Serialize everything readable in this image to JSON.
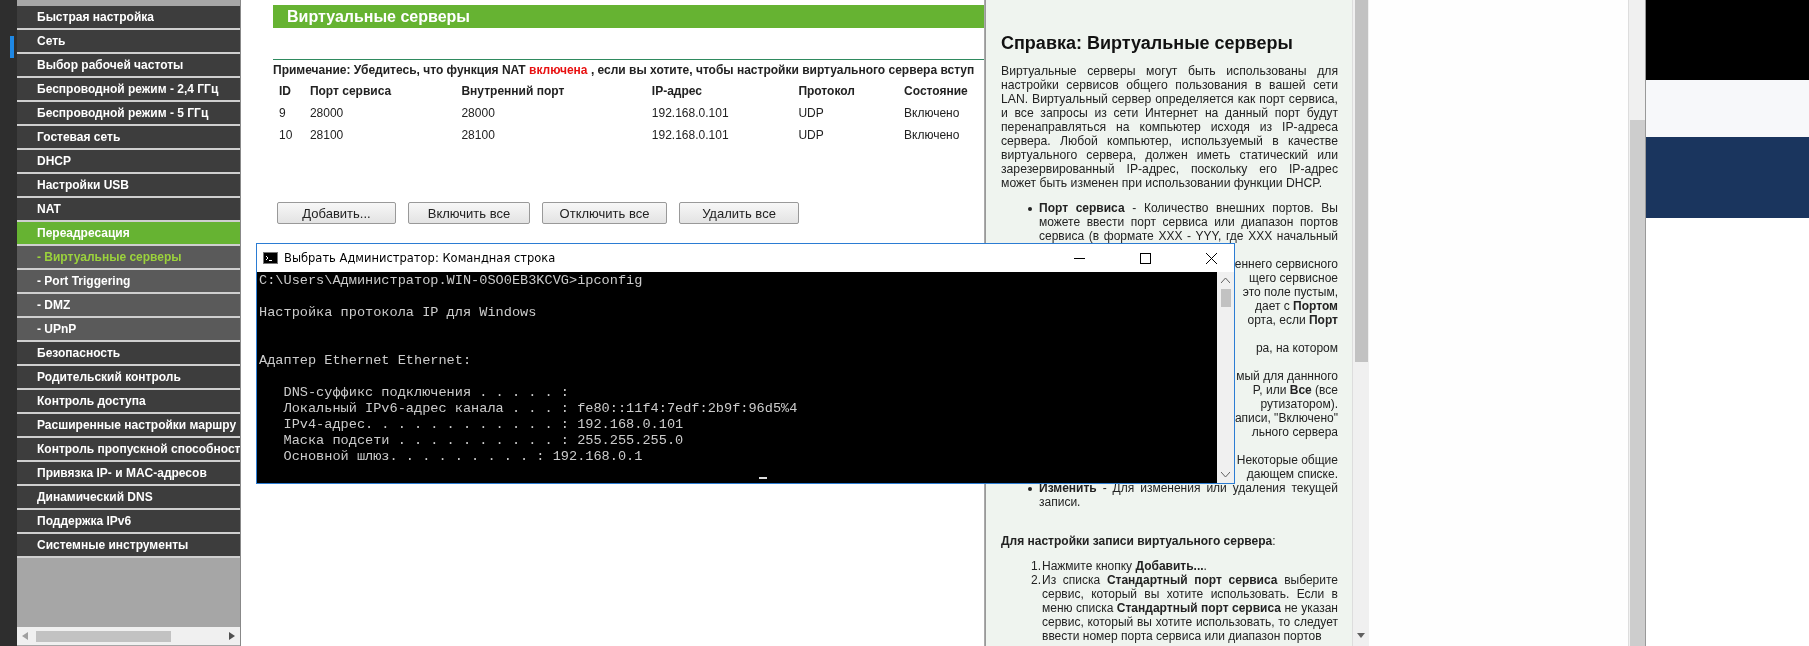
{
  "sidebar": {
    "items": [
      {
        "label": "Быстрая настройка",
        "kind": "main",
        "selected": false
      },
      {
        "label": "Сеть",
        "kind": "main",
        "selected": false
      },
      {
        "label": "Выбор рабочей частоты",
        "kind": "main",
        "selected": false
      },
      {
        "label": "Беспроводной режим - 2,4 ГГц",
        "kind": "main",
        "selected": false
      },
      {
        "label": "Беспроводной режим - 5 ГГц",
        "kind": "main",
        "selected": false
      },
      {
        "label": "Гостевая сеть",
        "kind": "main",
        "selected": false
      },
      {
        "label": "DHCP",
        "kind": "main",
        "selected": false
      },
      {
        "label": "Настройки USB",
        "kind": "main",
        "selected": false
      },
      {
        "label": "NAT",
        "kind": "main",
        "selected": false
      },
      {
        "label": "Переадресация",
        "kind": "main",
        "selected": true
      },
      {
        "label": "- Виртуальные серверы",
        "kind": "sub",
        "selected": true
      },
      {
        "label": "- Port Triggering",
        "kind": "sub",
        "selected": false
      },
      {
        "label": "- DMZ",
        "kind": "sub",
        "selected": false
      },
      {
        "label": "- UPnP",
        "kind": "sub",
        "selected": false
      },
      {
        "label": "Безопасность",
        "kind": "main",
        "selected": false
      },
      {
        "label": "Родительский контроль",
        "kind": "main",
        "selected": false
      },
      {
        "label": "Контроль доступа",
        "kind": "main",
        "selected": false
      },
      {
        "label": "Расширенные настройки маршру",
        "kind": "main",
        "selected": false
      },
      {
        "label": "Контроль пропускной способност",
        "kind": "main",
        "selected": false
      },
      {
        "label": "Привязка IP- и MAC-адресов",
        "kind": "main",
        "selected": false
      },
      {
        "label": "Динамический DNS",
        "kind": "main",
        "selected": false
      },
      {
        "label": "Поддержка IPv6",
        "kind": "main",
        "selected": false
      },
      {
        "label": "Системные инструменты",
        "kind": "main",
        "selected": false
      }
    ]
  },
  "main": {
    "title": "Виртуальные серверы",
    "note": {
      "before": "Примечание: Убедитесь, что функция NAT",
      "highlight": "включена",
      "after": ", если вы хотите, чтобы настройки виртуального сервера вступ"
    },
    "table": {
      "columns": [
        "ID",
        "Порт сервиса",
        "Внутренний порт",
        "IP-адрес",
        "Протокол",
        "Состояние"
      ],
      "rows": [
        [
          "9",
          "28000",
          "28000",
          "192.168.0.101",
          "UDP",
          "Включено"
        ],
        [
          "10",
          "28100",
          "28100",
          "192.168.0.101",
          "UDP",
          "Включено"
        ]
      ]
    },
    "buttons": [
      "Добавить...",
      "Включить все",
      "Отключить все",
      "Удалить все"
    ]
  },
  "help": {
    "title": "Справка: Виртуальные серверы",
    "sections": [
      {
        "kind": "paragraph",
        "text": "Виртуальные серверы могут быть использованы для настройки сервисов общего пользования в вашей сети LAN. Виртуальный сервер определяется как порт сервиса, и все запросы из сети Интернет на данный порт будут перенаправляться на компьютер исходя из IP-адреса сервера. Любой компьютер, используемый в качестве виртуального сервера, должен иметь статический или зарезервированный IP-адрес, поскольку его IP-адрес может быть изменен при использовании функции DHCP."
      },
      {
        "kind": "bullet",
        "text": "**Порт сервиса** - Количество внешних портов. Вы можете ввести порт сервиса или диапазон портов сервиса (в формате XXX - YYY, где XXX начальный"
      },
      {
        "kind": "fragments",
        "lines": [
          "еннего сервисного",
          "щего сервисное",
          "это поле пустым,",
          "дает с **Портом**",
          "орта, если **Порт**"
        ]
      },
      {
        "kind": "fragments",
        "lines": [
          "ра, на котором"
        ]
      },
      {
        "kind": "fragments",
        "lines": [
          "мый для даннного",
          "P, или **Все** (все",
          "рутизатором).",
          "аписи, \"Включено\"",
          "льного сервера"
        ]
      },
      {
        "kind": "fragments",
        "lines": [
          "Некоторые общие",
          "дающем списке."
        ]
      },
      {
        "kind": "bullet",
        "text": "**Изменить** - Для изменения или удаления текущей записи."
      },
      {
        "kind": "heading",
        "text": "**Для настройки записи виртуального сервера**:"
      },
      {
        "kind": "step",
        "number": "1.",
        "text": "Нажмите кнопку **Добавить...**."
      },
      {
        "kind": "step",
        "number": "2.",
        "text": "Из списка **Стандартный порт сервиса** выберите сервис, который вы хотите использовать. Если в меню списка **Стандартный порт сервиса** не указан сервис, который вы хотите использовать, то следует ввести номер порта сервиса или диапазон портов"
      }
    ]
  },
  "console": {
    "title": "Выбрать Администратор: Командная строка",
    "output": "C:\\Users\\Администратор.WIN-0SO0EB3KCVG>ipconfig\n\nНастройка протокола IP для Windows\n\n\nАдаптер Ethernet Ethernet:\n\n   DNS-суффикс подключения . . . . . :\n   Локальный IPv6-адрес канала . . . : fe80::11f4:7edf:2b9f:96d5%4\n   IPv4-адрес. . . . . . . . . . . . : 192.168.0.101\n   Маска подсети . . . . . . . . . . : 255.255.255.0\n   Основной шлюз. . . . . . . . . : 192.168.0.1"
  }
}
